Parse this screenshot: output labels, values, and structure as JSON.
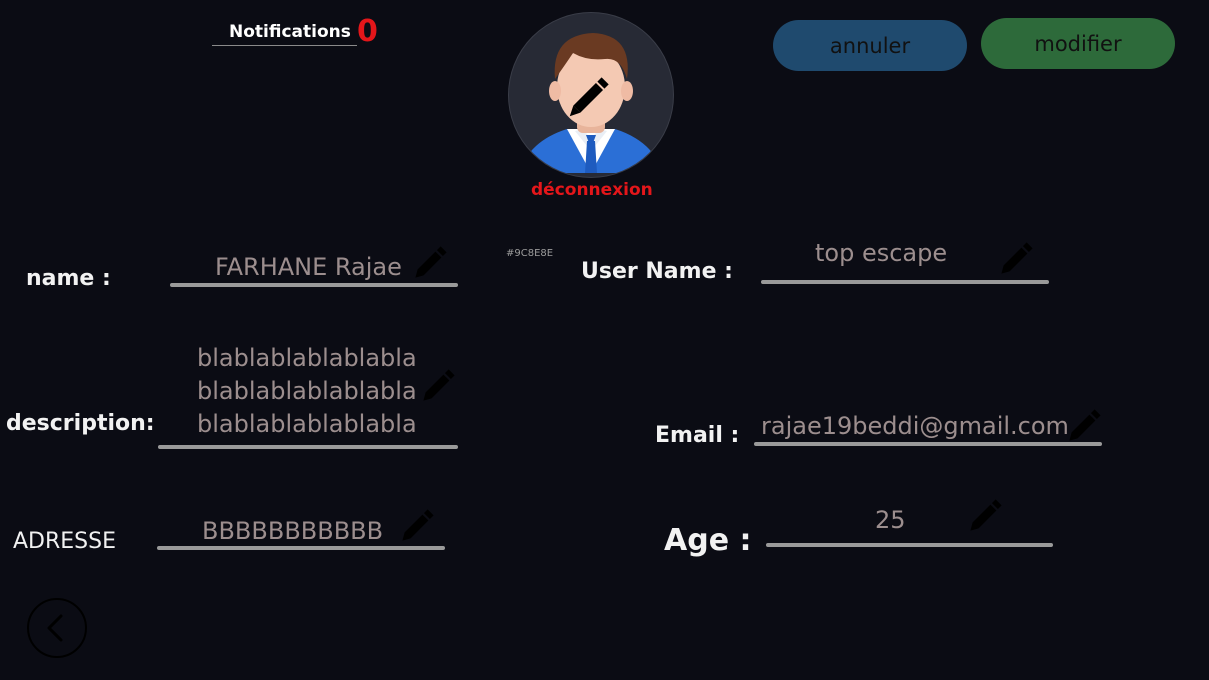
{
  "header": {
    "notifications_label": "Notifications",
    "notifications_count": "0",
    "logout_label": "déconnexion",
    "cancel_label": "annuler",
    "modify_label": "modifier"
  },
  "hex_note": "#9C8E8E",
  "fields": {
    "name": {
      "label": "name :",
      "value": "FARHANE Rajae"
    },
    "username": {
      "label": "User Name :",
      "value": "top escape"
    },
    "description": {
      "label": "description:",
      "value": "blablablablablabla\nblablablablablabla\nblablablablablabla"
    },
    "email": {
      "label": "Email :",
      "value": "rajae19beddi@gmail.com"
    },
    "address": {
      "label": "ADRESSE",
      "value": "BBBBBBBBBBB"
    },
    "age": {
      "label": "Age :",
      "value": "25"
    }
  },
  "colors": {
    "background": "#0b0c14",
    "value_text": "#9c8e8e",
    "alert_red": "#e4161a",
    "cancel_button": "#1f4a6e",
    "modify_button": "#2d6a3a"
  },
  "icons": {
    "edit": "pencil-icon",
    "back": "chevron-left-icon",
    "avatar": "user-avatar"
  }
}
